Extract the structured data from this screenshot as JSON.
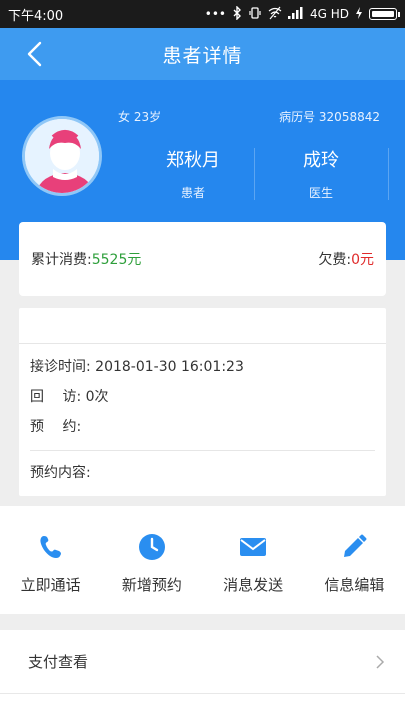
{
  "status": {
    "time": "下午4:00",
    "network": "4G HD",
    "icons": [
      "dots-icon",
      "bluetooth-icon",
      "vibrate-icon",
      "wifi-off-icon",
      "signal-icon",
      "battery-icon",
      "charging-icon"
    ]
  },
  "navbar": {
    "title": "患者详情",
    "back_icon": "back-chevron-icon"
  },
  "patient": {
    "gender_age": "女 23岁",
    "record_label": "病历号 32058842",
    "name": "郑秋月",
    "name_role": "患者",
    "doctor": "成玲",
    "doctor_role": "医生"
  },
  "fees": {
    "total_label": "累计消费:",
    "total_value": "5525元",
    "owed_label": "欠费:",
    "owed_value": "0元"
  },
  "info": {
    "visit_time": "接诊时间: 2018-01-30 16:01:23",
    "revisit": "回　 访: 0次",
    "appointment": "预　 约:",
    "appointment_content": "预约内容:"
  },
  "actions": [
    {
      "label": "立即通话",
      "icon": "phone-icon"
    },
    {
      "label": "新增预约",
      "icon": "clock-icon"
    },
    {
      "label": "消息发送",
      "icon": "mail-icon"
    },
    {
      "label": "信息编辑",
      "icon": "pencil-icon"
    }
  ],
  "list": [
    {
      "label": "支付查看"
    }
  ],
  "colors": {
    "accent": "#2587ee",
    "nav": "#3e9bf0",
    "green": "#2e9f3b",
    "red": "#e02a2a",
    "icon": "#2a8ef0"
  }
}
